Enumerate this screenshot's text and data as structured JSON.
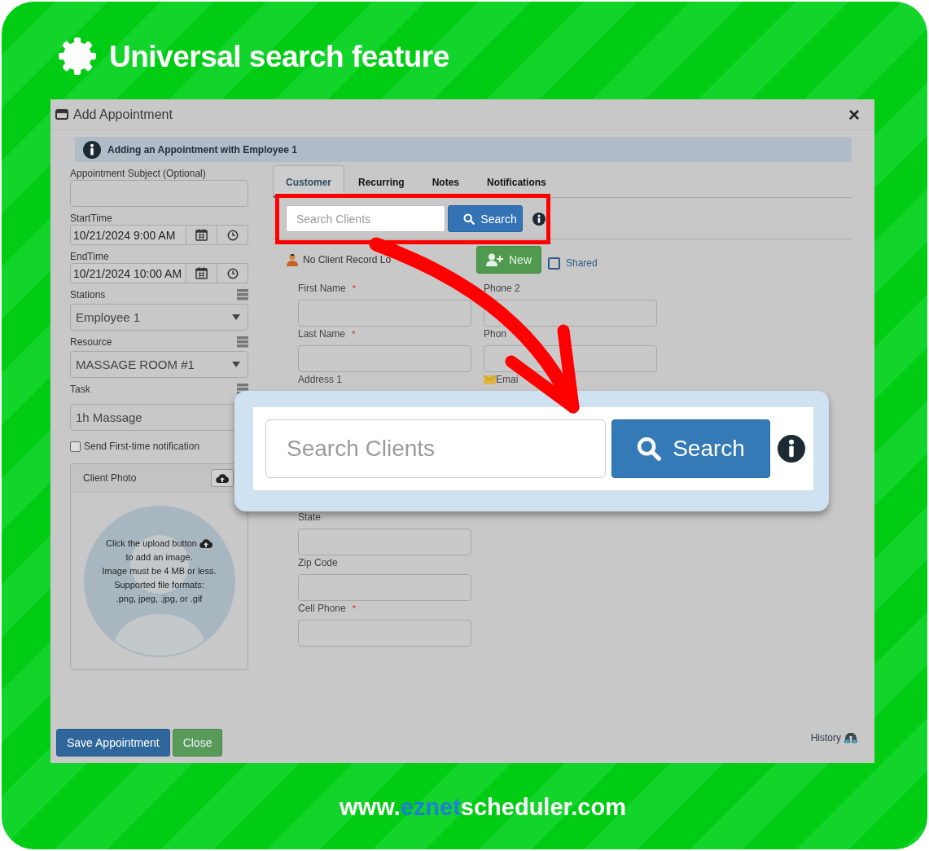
{
  "header": {
    "title": "Universal search feature"
  },
  "dialog": {
    "title": "Add Appointment",
    "close": "×",
    "alert": "Adding an Appointment with Employee 1"
  },
  "left_form": {
    "subject": {
      "label": "Appointment Subject (Optional)"
    },
    "start_time": {
      "label": "StartTime",
      "value": "10/21/2024 9:00 AM"
    },
    "end_time": {
      "label": "EndTime",
      "value": "10/21/2024 10:00 AM"
    },
    "selects": [
      {
        "label": "Stations",
        "value": "Employee 1",
        "caret": true
      },
      {
        "label": "Resource",
        "value": "MASSAGE ROOM #1",
        "caret": true
      },
      {
        "label": "Task",
        "value": "1h Massage",
        "caret": false
      }
    ],
    "send_notification": {
      "label": "Send First-time notification",
      "checked": false
    },
    "client_photo": {
      "title": "Client Photo",
      "help_lines": [
        "Click the upload button",
        "to add an image.",
        "Image must be 4 MB or less.",
        "Supported file formats:",
        ".png, jpeg, .jpg, or .gif"
      ]
    }
  },
  "tabs": [
    {
      "label": "Customer",
      "selected": true
    },
    {
      "label": "Recurring",
      "selected": false
    },
    {
      "label": "Notes",
      "selected": false
    },
    {
      "label": "Notifications",
      "selected": false
    }
  ],
  "client_search": {
    "placeholder": "Search Clients",
    "button": "Search"
  },
  "client_status": "No Client Record Lo",
  "new_button": "New",
  "shared": {
    "label": "Shared",
    "checked": false
  },
  "fields_left": [
    {
      "kind": "input",
      "label": "First Name",
      "mark": "*"
    },
    {
      "kind": "input",
      "label": "Last Name",
      "mark": "*"
    },
    {
      "kind": "label",
      "label": "Address 1"
    },
    {
      "kind": "input",
      "label": "State"
    },
    {
      "kind": "input",
      "label": "Zip Code"
    },
    {
      "kind": "input",
      "label": "Cell Phone",
      "mark": "*"
    }
  ],
  "fields_right": [
    {
      "kind": "input",
      "label": "Phone 2"
    },
    {
      "kind": "input",
      "label": "Phon"
    },
    {
      "kind": "email",
      "label": "Emai"
    }
  ],
  "footer": {
    "save": "Save Appointment",
    "close": "Close",
    "history": "History"
  },
  "callout": {
    "placeholder": "Search Clients",
    "button": "Search"
  },
  "website": {
    "prefix": "www.",
    "brand": "eznet",
    "suffix": "scheduler.com"
  }
}
